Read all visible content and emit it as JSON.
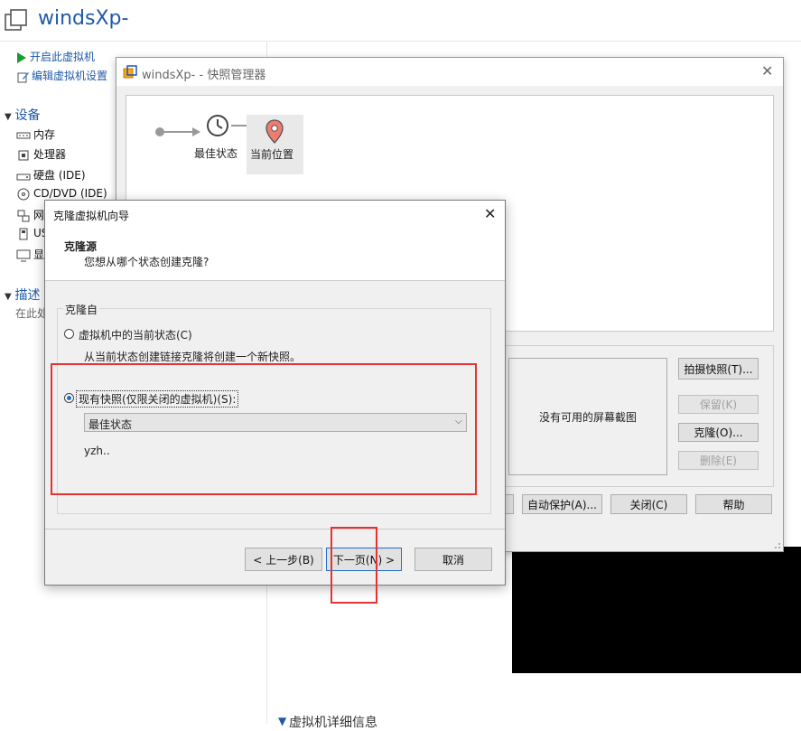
{
  "main_window": {
    "title": "windsXp-",
    "actions": [
      "开启此虚拟机",
      "编辑虚拟机设置"
    ],
    "devices_title": "设备",
    "devices": [
      "内存",
      "处理器",
      "硬盘 (IDE)",
      "CD/DVD (IDE)",
      "网",
      "US",
      "显"
    ],
    "description_title": "描述",
    "description_text": "在此处",
    "details_title": "虚拟机详细信息"
  },
  "snapshot_manager": {
    "title": "windsXp- - 快照管理器",
    "tree": {
      "best_state": "最佳状态",
      "current_position": "当前位置"
    },
    "screenshot_placeholder": "没有可用的屏幕截图",
    "buttons": {
      "take_snapshot": "拍摄快照(T)...",
      "keep": "保留(K)",
      "clone": "克隆(O)...",
      "delete": "删除(E)",
      "autoprotect": "自动保护(A)...",
      "close": "关闭(C)",
      "help": "帮助"
    }
  },
  "clone_wizard": {
    "title": "克隆虚拟机向导",
    "header_title": "克隆源",
    "header_subtitle": "您想从哪个状态创建克隆?",
    "group_label": "克隆自",
    "option_current": "虚拟机中的当前状态(C)",
    "option_current_desc": "从当前状态创建链接克隆将创建一个新快照。",
    "option_existing": "现有快照(仅限关闭的虚拟机)(S):",
    "selected_snapshot": "最佳状态",
    "snapshot_description": "yzh..",
    "buttons": {
      "back": "< 上一步(B)",
      "next": "下一页(N) >",
      "cancel": "取消"
    }
  },
  "colors": {
    "accent": "#1e5aa8",
    "highlight": "#e53333",
    "radio_dot": "#1f6ec7"
  }
}
